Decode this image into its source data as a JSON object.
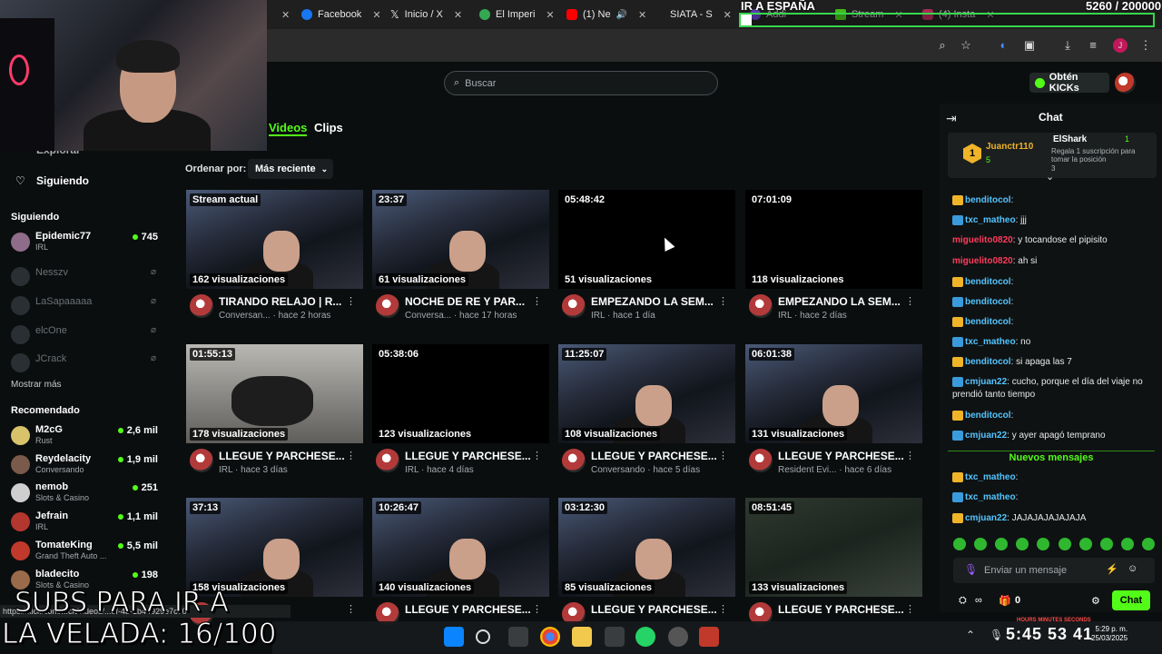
{
  "browser": {
    "tabs": [
      {
        "label": "Facebook",
        "color": "#1877f2"
      },
      {
        "label": "Inicio / X",
        "color": "#ffffff"
      },
      {
        "label": "El Imperi",
        "color": "#34a853"
      },
      {
        "label": "(1) Ne",
        "color": "#ff0000"
      },
      {
        "label": "SIATA - S",
        "color": "#888888"
      },
      {
        "label": "Addi",
        "color": "#7c4dff"
      },
      {
        "label": "Stream",
        "color": "#53fc18"
      },
      {
        "label": "(4) Insta",
        "color": "#e1306c"
      }
    ]
  },
  "overlay": {
    "goal_title": "IR A ESPAÑA",
    "goal_count": "5260 / 200000",
    "goal_current": 5260,
    "goal_target": 200000,
    "subs_line1": "SUBS PARA IR A",
    "subs_line2": "LA VELADA: 16/100",
    "bar_color": "#36d64c"
  },
  "header": {
    "search_placeholder": "Buscar",
    "kicks_label": "Obtén KICKs"
  },
  "sidebar": {
    "explorar": "Explorar",
    "siguiendo_link": "Siguiendo",
    "following_heading": "Siguiendo",
    "following": [
      {
        "name": "Epidemic77",
        "category": "IRL",
        "viewers": "745",
        "live": true
      },
      {
        "name": "Nesszv",
        "live": false
      },
      {
        "name": "LaSapaaaaa",
        "live": false
      },
      {
        "name": "elcOne",
        "live": false
      },
      {
        "name": "JCrack",
        "live": false
      }
    ],
    "show_more": "Mostrar más",
    "recommended_heading": "Recomendado",
    "recommended": [
      {
        "name": "M2cG",
        "category": "Rust",
        "viewers": "2,6 mil"
      },
      {
        "name": "Reydelacity",
        "category": "Conversando",
        "viewers": "1,9 mil"
      },
      {
        "name": "nemob",
        "category": "Slots & Casino",
        "viewers": "251"
      },
      {
        "name": "Jefrain",
        "category": "IRL",
        "viewers": "1,1 mil"
      },
      {
        "name": "TomateKing",
        "category": "Grand Theft Auto ...",
        "viewers": "5,5 mil"
      },
      {
        "name": "bladecito",
        "category": "Slots & Casino",
        "viewers": "198"
      }
    ]
  },
  "main": {
    "tabs": [
      "Videos",
      "Clips"
    ],
    "sort_label": "Ordenar por:",
    "sort_value": "Más reciente",
    "videos": [
      {
        "duration": "Stream actual",
        "views": "162 visualizaciones",
        "title": "TIRANDO RELAJO | R...",
        "category": "Conversan...",
        "ago": "hace 2 horas",
        "thumb": "scene"
      },
      {
        "duration": "23:37",
        "views": "61 visualizaciones",
        "title": "NOCHE DE RE Y PAR...",
        "category": "Conversa...",
        "ago": "hace 17 horas",
        "thumb": "scene"
      },
      {
        "duration": "05:48:42",
        "views": "51 visualizaciones",
        "title": "EMPEZANDO LA SEM...",
        "category": "IRL",
        "ago": "hace 1 día",
        "thumb": "black"
      },
      {
        "duration": "07:01:09",
        "views": "118 visualizaciones",
        "title": "EMPEZANDO LA SEM...",
        "category": "IRL",
        "ago": "hace 2 días",
        "thumb": "black"
      },
      {
        "duration": "01:55:13",
        "views": "178 visualizaciones",
        "title": "LLEGUE Y PARCHESE...",
        "category": "IRL",
        "ago": "hace 3 días",
        "thumb": "street"
      },
      {
        "duration": "05:38:06",
        "views": "123 visualizaciones",
        "title": "LLEGUE Y PARCHESE...",
        "category": "IRL",
        "ago": "hace 4 días",
        "thumb": "black"
      },
      {
        "duration": "11:25:07",
        "views": "108 visualizaciones",
        "title": "LLEGUE Y PARCHESE...",
        "category": "Conversando",
        "ago": "hace 5 días",
        "thumb": "scene"
      },
      {
        "duration": "06:01:38",
        "views": "131 visualizaciones",
        "title": "LLEGUE Y PARCHESE...",
        "category": "Resident Evi...",
        "ago": "hace 6 días",
        "thumb": "scene"
      },
      {
        "duration": "37:13",
        "views": "158 visualizaciones",
        "title": "CHESE...",
        "category": "",
        "ago": "",
        "thumb": "scene"
      },
      {
        "duration": "10:26:47",
        "views": "140 visualizaciones",
        "title": "LLEGUE Y PARCHESE...",
        "category": "",
        "ago": "",
        "thumb": "scene"
      },
      {
        "duration": "03:12:30",
        "views": "85 visualizaciones",
        "title": "LLEGUE Y PARCHESE...",
        "category": "",
        "ago": "",
        "thumb": "scene"
      },
      {
        "duration": "08:51:45",
        "views": "133 visualizaciones",
        "title": "LLEGUE Y PARCHESE...",
        "category": "",
        "ago": "",
        "thumb": "game"
      }
    ],
    "url_hint": "https://kick.com/...ck/videos/...8f-4b-1b44929e7c70"
  },
  "chat": {
    "title": "Chat",
    "pinned": {
      "rank": "1",
      "top_user": "Juanctr110",
      "top_count": "5",
      "gifter": "ElShark",
      "gifter_count": "1",
      "note": "Regala 1 suscripción para tomar la posición",
      "note_num": "3"
    },
    "messages": [
      {
        "user": "benditocol",
        "text": "",
        "color": "#53c5ff"
      },
      {
        "user": "txc_matheo",
        "text": "jjj",
        "color": "#53c5ff"
      },
      {
        "user": "miguelito0820",
        "text": "y tocandose el pipisito",
        "color": "#ff3b5c"
      },
      {
        "user": "miguelito0820",
        "text": "ah si",
        "color": "#ff3b5c"
      },
      {
        "user": "benditocol",
        "text": "",
        "color": "#53c5ff"
      },
      {
        "user": "benditocol",
        "text": "",
        "color": "#53c5ff"
      },
      {
        "user": "benditocol",
        "text": "",
        "color": "#53c5ff"
      },
      {
        "user": "txc_matheo",
        "text": "no",
        "color": "#53c5ff"
      },
      {
        "user": "benditocol",
        "text": "si apaga las 7",
        "color": "#53c5ff"
      },
      {
        "user": "cmjuan22",
        "text": "cucho, porque el día del viaje no prendió tanto tiempo",
        "color": "#53c5ff"
      },
      {
        "user": "benditocol",
        "text": "",
        "color": "#53c5ff"
      },
      {
        "user": "cmjuan22",
        "text": "y ayer apagó temprano",
        "color": "#53c5ff"
      }
    ],
    "new_messages_label": "Nuevos mensajes",
    "new_messages": [
      {
        "user": "txc_matheo",
        "text": "",
        "color": "#53c5ff"
      },
      {
        "user": "txc_matheo",
        "text": "",
        "color": "#53c5ff"
      },
      {
        "user": "cmjuan22",
        "text": "JAJAJAJAJAJAJA",
        "color": "#53c5ff"
      }
    ],
    "input_placeholder": "Enviar un mensaje",
    "points": "0",
    "send_label": "Chat"
  },
  "taskbar": {
    "timer": "5:45 53 41",
    "timer_units": "HOURS  MINUTES  SECONDS",
    "time": "5:29 p. m.",
    "date": "25/03/2025"
  },
  "accent": "#53fc18"
}
